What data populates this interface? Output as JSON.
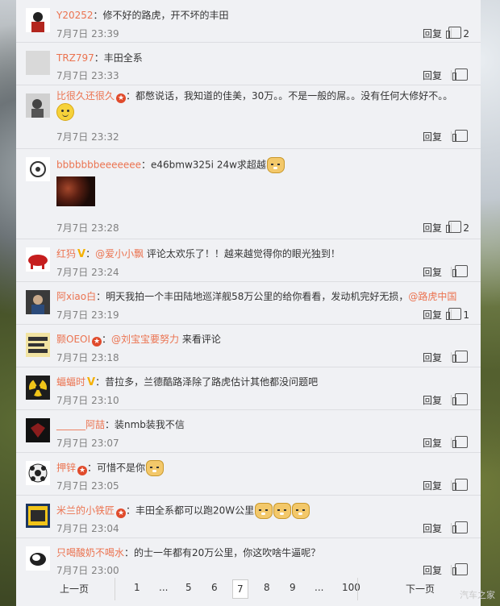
{
  "comments": [
    {
      "user": "Y20252",
      "text": "：修不好的路虎，开不坏的丰田",
      "time": "7月7日 23:39",
      "reply": "回复",
      "likes": "2"
    },
    {
      "user": "TRZ797",
      "text": "：丰田全系",
      "time": "7月7日 23:33",
      "reply": "回复",
      "likes": ""
    },
    {
      "user": "比很久还很久",
      "text": "：都憋说话，我知道的佳美，30万。。不是一般的屌。。没有任何大修好不。。",
      "time": "7月7日 23:32",
      "reply": "回复",
      "likes": ""
    },
    {
      "user": "bbbbbbbeeeeeee",
      "text": "：e46bmw325i 24w求超越",
      "time": "7月7日 23:28",
      "reply": "回复",
      "likes": "2"
    },
    {
      "user": "红犸",
      "mention": "@爱小小飘",
      "text": " 评论太欢乐了！！越来越觉得你的眼光独到！",
      "time": "7月7日 23:24",
      "reply": "回复",
      "likes": ""
    },
    {
      "user": "阿xiao白",
      "text": "：明天我拍一个丰田陆地巡洋舰58万公里的给你看看，发动机完好无损，",
      "mention": "@路虎中国",
      "time": "7月7日 23:19",
      "reply": "回复",
      "likes": "1"
    },
    {
      "user": "颢OEOI",
      "mention": "@刘宝宝要努力",
      "text": " 来看评论",
      "time": "7月7日 23:18",
      "reply": "回复",
      "likes": ""
    },
    {
      "user": "蝠蝠时",
      "text": "：昔拉多，兰德酷路泽除了路虎估计其他都没问题吧",
      "time": "7月7日 23:10",
      "reply": "回复",
      "likes": ""
    },
    {
      "user": "______阿喆",
      "text": "：装nmb装我不信",
      "time": "7月7日 23:07",
      "reply": "回复",
      "likes": ""
    },
    {
      "user": "押锌",
      "text": "：可惜不是你",
      "time": "7月7日 23:05",
      "reply": "回复",
      "likes": ""
    },
    {
      "user": "米兰的小铁匠",
      "text": "：丰田全系都可以跑20W公里",
      "time": "7月7日 23:04",
      "reply": "回复",
      "likes": ""
    },
    {
      "user": "只喝酸奶不喝水",
      "text": "：的士一年都有20万公里，你这吹啥牛逼呢？",
      "time": "7月7日 23:00",
      "reply": "回复",
      "likes": ""
    }
  ],
  "pager": {
    "prev": "上一页",
    "next": "下一页",
    "pages": [
      "1",
      "...",
      "5",
      "6",
      "7",
      "8",
      "9",
      "...",
      "100"
    ],
    "current": "7"
  },
  "watermark": "汽车之家"
}
